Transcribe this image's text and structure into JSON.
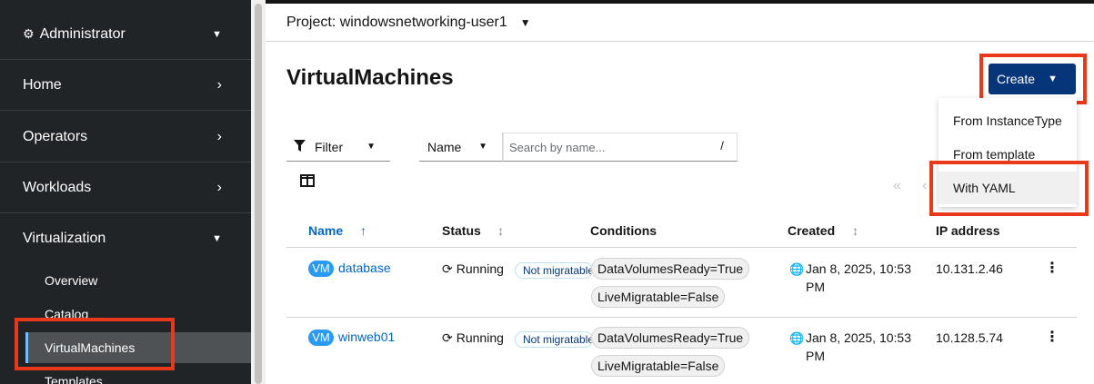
{
  "sidebar": {
    "perspective": "Administrator",
    "sections": [
      {
        "label": "Home"
      },
      {
        "label": "Operators"
      },
      {
        "label": "Workloads"
      },
      {
        "label": "Virtualization"
      }
    ],
    "virtualization_items": [
      {
        "label": "Overview"
      },
      {
        "label": "Catalog"
      },
      {
        "label": "VirtualMachines"
      },
      {
        "label": "Templates"
      }
    ]
  },
  "header": {
    "project_label": "Project: windowsnetworking-user1"
  },
  "page": {
    "title": "VirtualMachines",
    "create_label": "Create",
    "create_menu": [
      "From InstanceType",
      "From template",
      "With YAML"
    ]
  },
  "toolbar": {
    "filter_label": "Filter",
    "name_select": "Name",
    "search_placeholder": "Search by name...",
    "search_shortcut": "/"
  },
  "table": {
    "columns": [
      "Name",
      "Status",
      "Conditions",
      "Created",
      "IP address"
    ],
    "rows": [
      {
        "badge": "VM",
        "name": "database",
        "status": "Running",
        "migratable": "Not migratable",
        "conditions": [
          "DataVolumesReady=True",
          "LiveMigratable=False"
        ],
        "created_line1": "Jan 8, 2025, 10:53",
        "created_line2": "PM",
        "ip": "10.131.2.46"
      },
      {
        "badge": "VM",
        "name": "winweb01",
        "status": "Running",
        "migratable": "Not migratable",
        "conditions": [
          "DataVolumesReady=True",
          "LiveMigratable=False"
        ],
        "created_line1": "Jan 8, 2025, 10:53",
        "created_line2": "PM",
        "ip": "10.128.5.74"
      }
    ]
  },
  "colors": {
    "sidebar_bg": "#212427",
    "primary_button": "#06357a",
    "link": "#0066cc",
    "highlight_box": "#e8391d",
    "vm_badge": "#2b9af3"
  },
  "icons": {
    "perspective": "cogs-icon",
    "chevron_right": "chevron-right-icon",
    "chevron_down": "chevron-down-icon",
    "filter": "filter-icon",
    "columns": "columns-icon",
    "sort": "sort-icon",
    "sync": "sync-icon",
    "globe": "globe-icon",
    "kebab": "kebab-icon"
  }
}
